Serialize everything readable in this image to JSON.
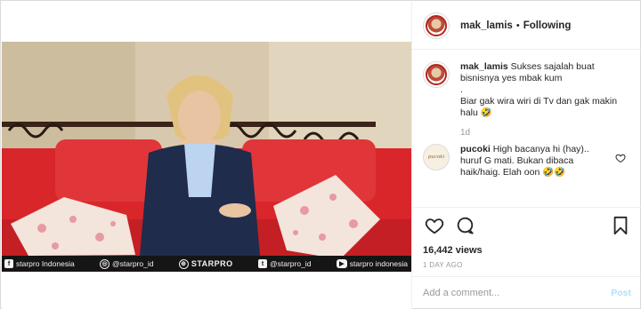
{
  "post": {
    "username": "mak_lamis",
    "separator": "•",
    "follow_status": "Following"
  },
  "caption": {
    "username": "mak_lamis",
    "lines": [
      "Sukses sajalah buat",
      "bisnisnya yes mbak kum",
      ".",
      "Biar gak wira wiri di Tv dan gak makin",
      "halu 🤣"
    ],
    "time": "1d"
  },
  "comment": {
    "username": "pucoki",
    "lines": [
      "High bacanya hi (hay)..",
      "huruf G mati. Bukan dibaca",
      "haik/haig. Elah oon 🤣🤣"
    ],
    "avatar_text": "pucoki"
  },
  "stats": {
    "views": "16,442 views",
    "date": "1 DAY AGO"
  },
  "add_comment": {
    "placeholder": "Add a comment...",
    "post_label": "Post"
  },
  "video_footer": {
    "facebook": "starpro Indonesia",
    "instagram": "@starpro_id",
    "brand": "STARPRO",
    "twitter": "@starpro_id",
    "youtube": "starpro indonesia"
  },
  "icons": {
    "heart": "heart-icon",
    "comment": "comment-icon",
    "bookmark": "bookmark-icon",
    "like_comment": "heart-small-icon"
  },
  "colors": {
    "sofa": "#d9262b",
    "post_button": "#b2dffc",
    "muted_text": "#999999"
  }
}
